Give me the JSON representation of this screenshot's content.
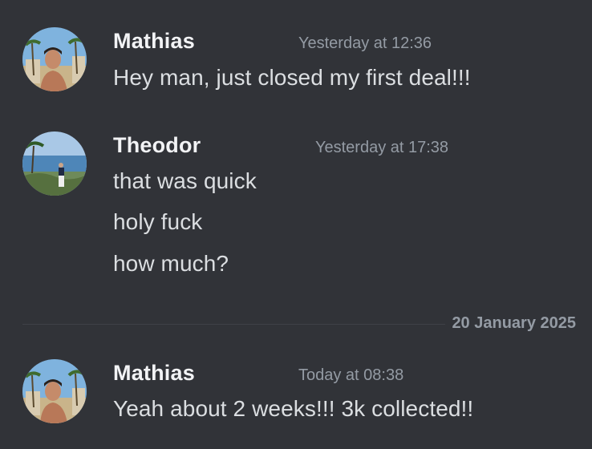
{
  "messages": [
    {
      "author": "Mathias",
      "timestamp": "Yesterday at 12:36",
      "avatar_icon": "user-avatar-photo",
      "lines": [
        "Hey man, just closed my first deal!!!"
      ]
    },
    {
      "author": "Theodor",
      "timestamp": "Yesterday at 17:38",
      "avatar_icon": "user-avatar-photo",
      "lines": [
        "that was quick",
        "holy fuck",
        "how much?"
      ]
    },
    {
      "author": "Mathias",
      "timestamp": "Today at 08:38",
      "avatar_icon": "user-avatar-photo",
      "lines": [
        "Yeah about 2 weeks!!! 3k collected!!"
      ]
    }
  ],
  "date_divider": {
    "label": "20 January 2025"
  },
  "colors": {
    "background": "#313338",
    "username": "#f2f3f5",
    "text": "#dbdee1",
    "muted": "#949ba4",
    "divider": "#3f4147"
  }
}
